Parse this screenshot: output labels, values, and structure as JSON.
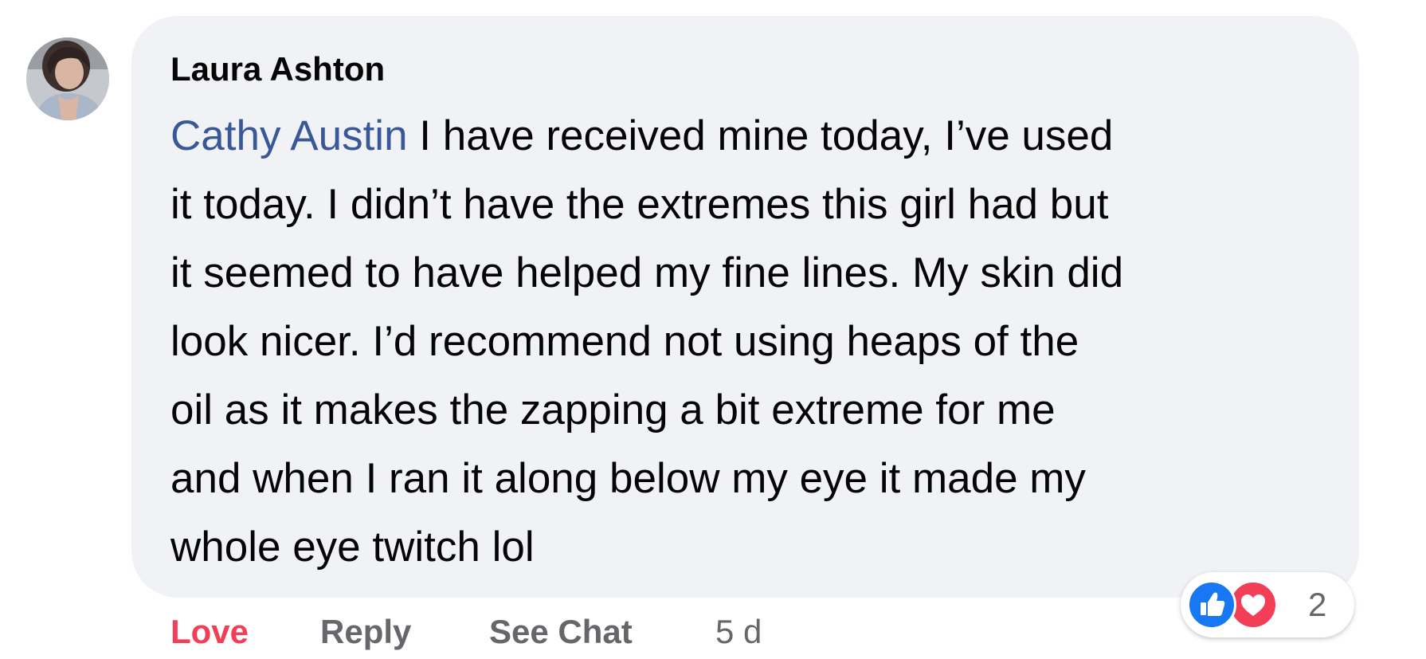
{
  "comment": {
    "author": "Laura Ashton",
    "mention": "Cathy Austin",
    "text_lines": [
      " I have received mine today, I’ve used",
      "it today. I didn’t have the extremes this girl had but",
      "it seemed to have helped my fine lines. My skin did",
      "look nicer. I’d recommend not using heaps of the",
      "oil as it makes the zapping a bit extreme for me",
      "and when I ran it along below my eye it made my",
      "whole eye twitch lol"
    ],
    "reactions": {
      "icons": [
        "like-icon",
        "love-icon"
      ],
      "count": "2"
    },
    "actions": {
      "love_label": "Love",
      "reply_label": "Reply",
      "see_chat_label": "See Chat",
      "timestamp": "5 d"
    }
  },
  "colors": {
    "bubble_bg": "#f0f2f5",
    "mention": "#385898",
    "love": "#f33e58",
    "like": "#1877f2",
    "secondary_text": "#65676b"
  }
}
